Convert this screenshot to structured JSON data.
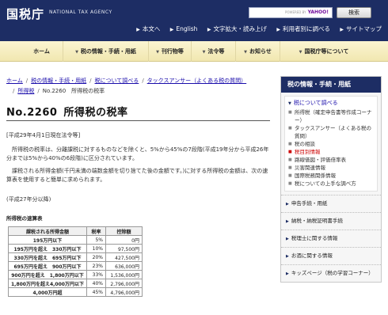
{
  "header": {
    "brand": "国税庁",
    "brand_en": "NATIONAL TAX AGENCY",
    "search_provider": "YAHOO!",
    "search_powered": "POWERED BY",
    "search_button": "検索",
    "utilities": [
      "本文へ",
      "English",
      "文字拡大・読み上げ",
      "利用者別に調べる",
      "サイトマップ"
    ]
  },
  "gnav": {
    "home": "ホーム",
    "items": [
      "税の情報・手続・用紙",
      "刊行物等",
      "法令等",
      "お知らせ",
      "国税庁等について"
    ]
  },
  "breadcrumb": {
    "items": [
      "ホーム",
      "税の情報・手続・用紙",
      "税について調べる",
      "タックスアンサー（よくある税の質問）",
      "所得税"
    ],
    "current": "No.2260　所得税の税率"
  },
  "main": {
    "title_num": "No.2260",
    "title_text": "所得税の税率",
    "date": "[平成29年4月1日現在法令等]",
    "p1": "所得税の税率は、分離課税に対するものなどを除くと、5%から45%の7段階(平成19年分から平成26年分までは5%から40%の6段階)に区分されています。",
    "p2": "課税される所得金額(千円未満の端数金額を切り捨てた後の金額です。)に対する所得税の金額は、次の速算表を使用すると簡単に求められます。",
    "p3": "(平成27年分以降)",
    "table_caption": "所得税の速算表",
    "table": {
      "headers": [
        "課税される所得金額",
        "税率",
        "控除額"
      ],
      "rows": [
        [
          "195万円以下",
          "5%",
          "0円"
        ],
        [
          "195万円を超え　330万円以下",
          "10%",
          "97,500円"
        ],
        [
          "330万円を超え　695万円以下",
          "20%",
          "427,500円"
        ],
        [
          "695万円を超え　900万円以下",
          "23%",
          "636,000円"
        ],
        [
          "900万円を超え　1,800万円以下",
          "33%",
          "1,536,000円"
        ],
        [
          "1,800万円を超え4,000万円以下",
          "40%",
          "2,796,000円"
        ],
        [
          "4,000万円超",
          "45%",
          "4,796,000円"
        ]
      ]
    }
  },
  "sidebar": {
    "title": "税の情報・手続・用紙",
    "current": "税について調べる",
    "items": [
      "所得税（確定申告書等作成コーナー）",
      "タックスアンサー（よくある税の質問）",
      "税の相談",
      "税目別情報",
      "路線価図・評価倍率表",
      "災害関連情報",
      "国際税務関係情報",
      "税についての上手な調べ方"
    ],
    "active_index": 3,
    "groups": [
      "申告手続・用紙",
      "納税・納税証明書手続",
      "税理士に関する情報",
      "お酒に関する情報",
      "キッズページ（税の学習コーナー）"
    ]
  },
  "colors": {
    "header_bg": "#1d2d64",
    "nav_bg": "#f5edc0",
    "active_link": "#cc0000"
  }
}
